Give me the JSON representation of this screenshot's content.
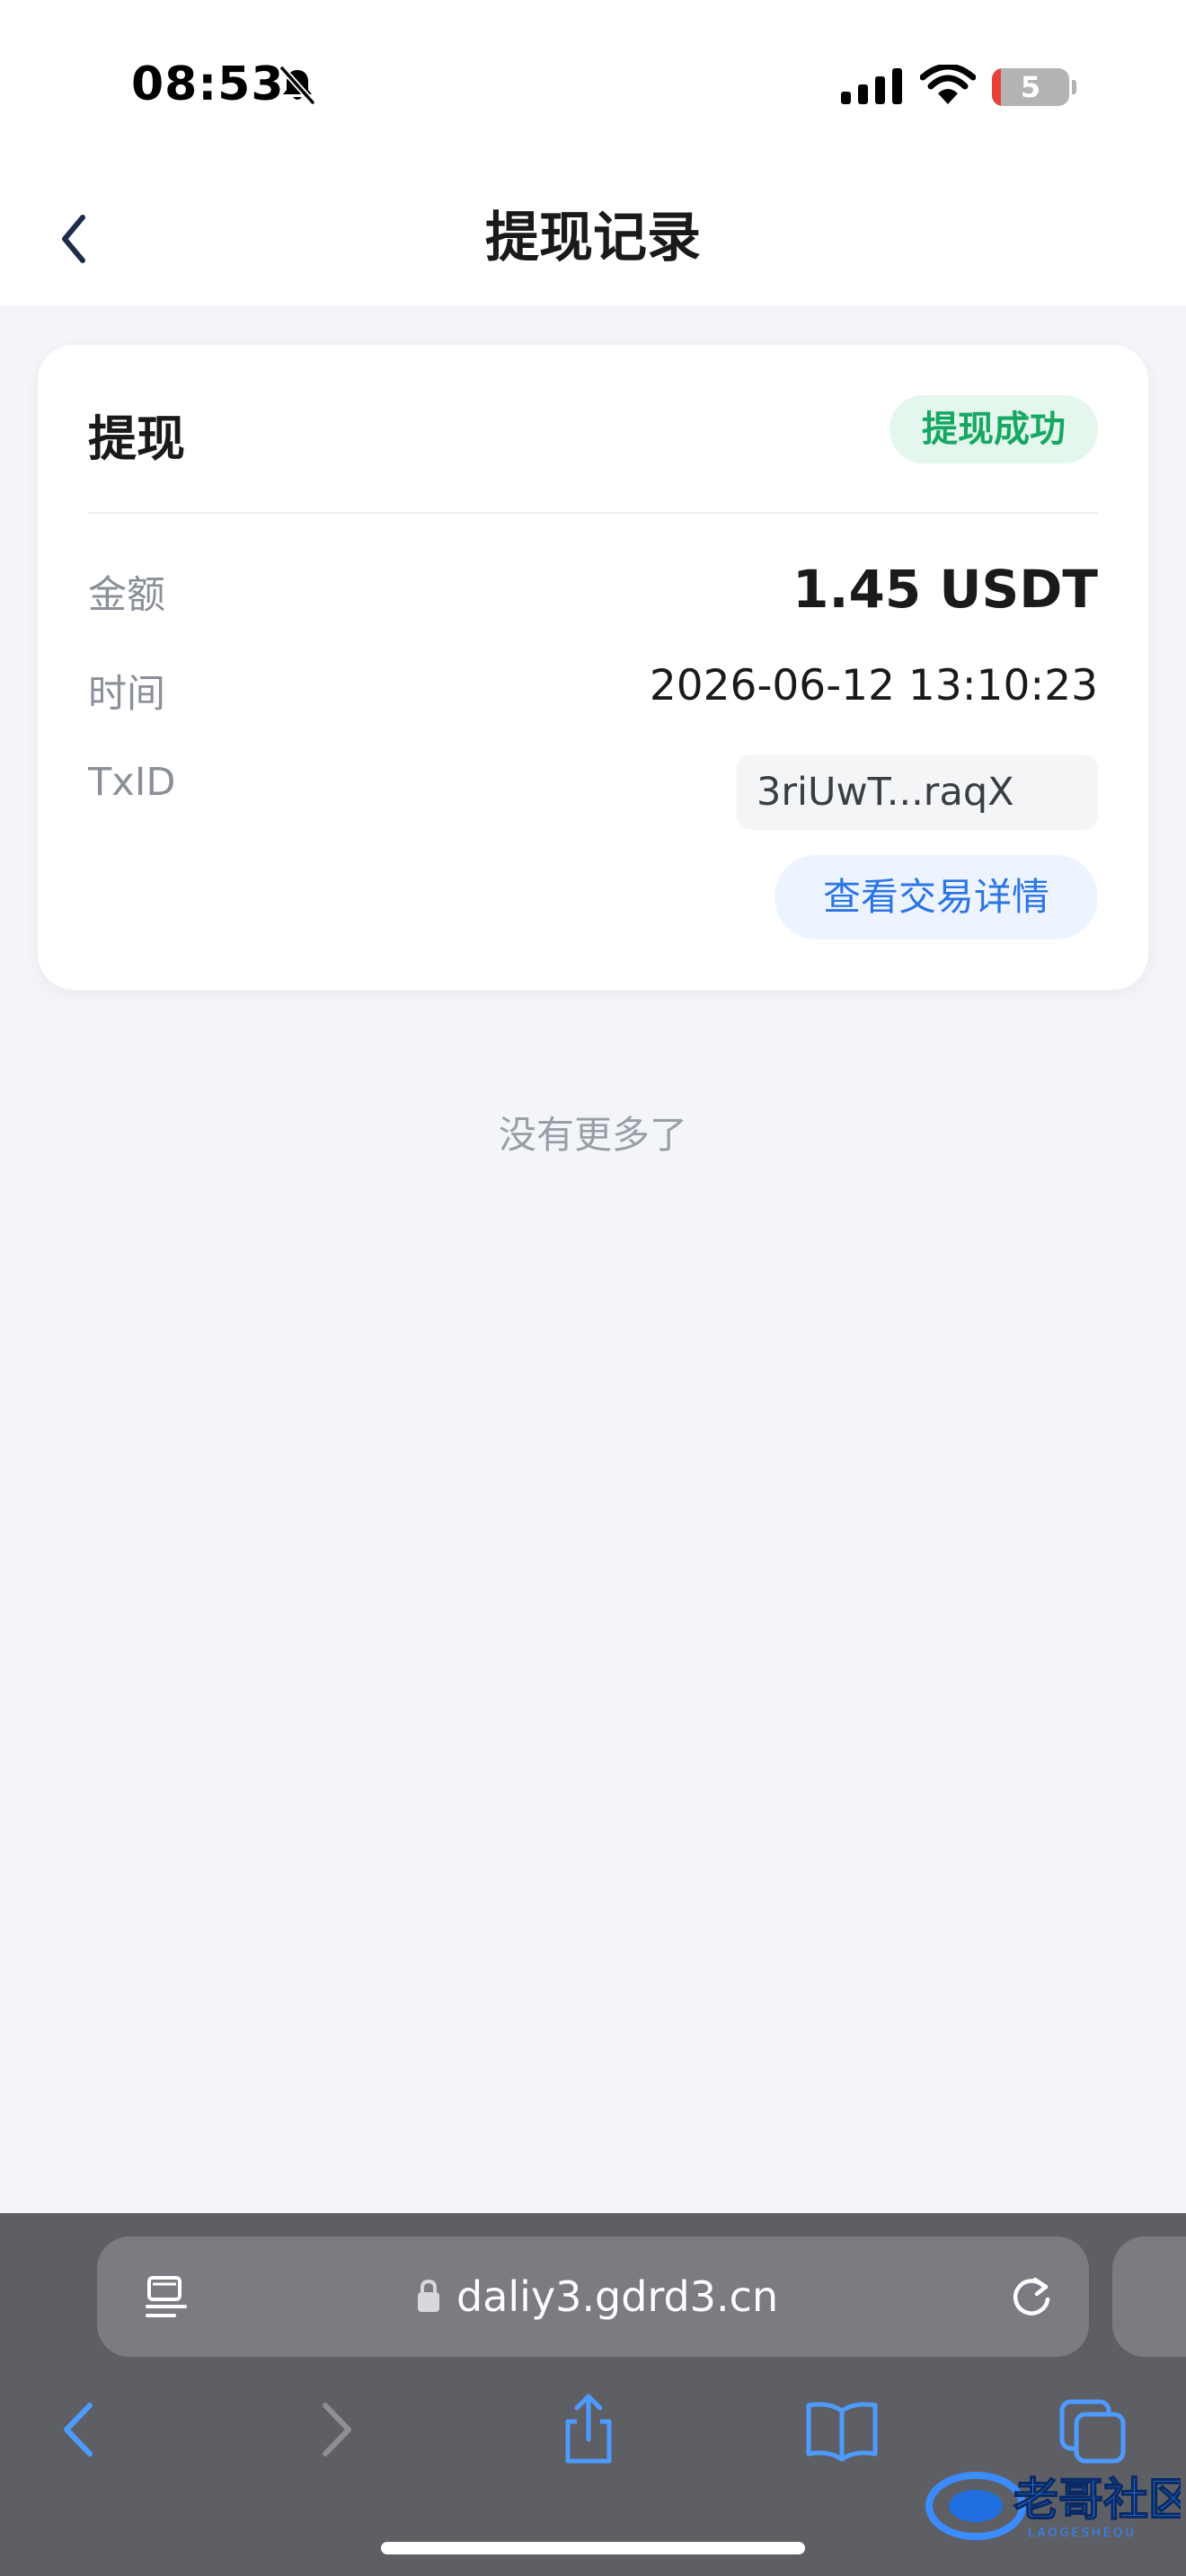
{
  "status_bar": {
    "time": "08:53",
    "battery_level": "5",
    "icons": [
      "bell-slash-icon",
      "signal-icon",
      "wifi-icon",
      "battery-icon"
    ]
  },
  "header": {
    "title": "提现记录",
    "back_icon": "chevron-left-icon"
  },
  "record": {
    "type": "提现",
    "status": "提现成功",
    "amount_label": "金额",
    "amount_value": "1.45 USDT",
    "time_label": "时间",
    "time_value": "2026-06-12 13:10:23",
    "txid_label": "TxID",
    "txid_value": "3riUwT...raqX",
    "view_details_label": "查看交易详情"
  },
  "list_footer": "没有更多了",
  "browser": {
    "url": "daliy3.gdrd3.cn",
    "toolbar_icons": [
      "back-arrow-icon",
      "forward-arrow-icon",
      "share-icon",
      "bookmarks-icon",
      "tabs-icon"
    ]
  },
  "watermark": {
    "text": "老哥社区",
    "subtext": "LAOGESHEQU"
  },
  "colors": {
    "success": "#16a763",
    "success_bg": "#e3f7ec",
    "link": "#2b75e6",
    "link_bg": "#edf4ff",
    "page_bg": "#f3f5f9",
    "browser_bar": "#5e5f64"
  }
}
